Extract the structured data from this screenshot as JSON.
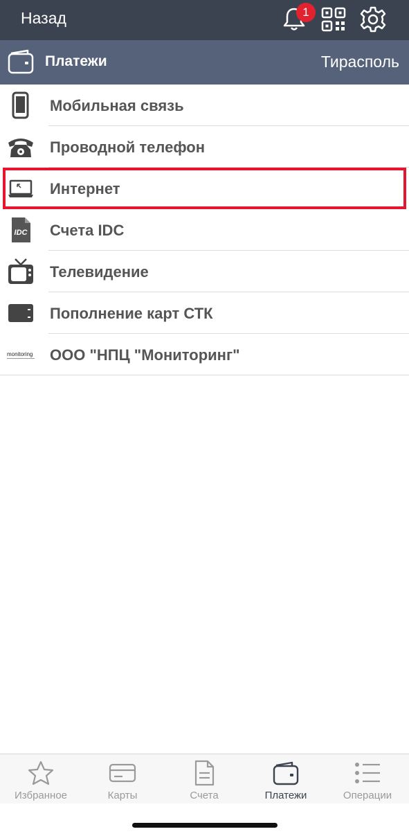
{
  "header": {
    "back_label": "Назад",
    "notification_count": "1"
  },
  "subheader": {
    "title": "Платежи",
    "city": "Тирасполь"
  },
  "categories": [
    {
      "label": "Мобильная связь",
      "icon": "mobile-phone-icon"
    },
    {
      "label": "Проводной телефон",
      "icon": "landline-phone-icon"
    },
    {
      "label": "Интернет",
      "icon": "laptop-icon"
    },
    {
      "label": "Счета IDC",
      "icon": "idc-logo-icon"
    },
    {
      "label": "Телевидение",
      "icon": "tv-icon"
    },
    {
      "label": "Пополнение карт СТК",
      "icon": "card-icon"
    },
    {
      "label": "ООО \"НПЦ \"Мониторинг\"",
      "icon": "monitoring-logo-icon",
      "logo_text": "monitoring"
    }
  ],
  "tabs": [
    {
      "label": "Избранное",
      "icon": "star-icon"
    },
    {
      "label": "Карты",
      "icon": "card-icon"
    },
    {
      "label": "Счета",
      "icon": "document-icon"
    },
    {
      "label": "Платежи",
      "icon": "wallet-icon",
      "active": true
    },
    {
      "label": "Операции",
      "icon": "list-icon"
    }
  ],
  "colors": {
    "topbar": "#3c4350",
    "subbar": "#56627a",
    "highlight": "#e3152f",
    "badge": "#e3222f"
  }
}
